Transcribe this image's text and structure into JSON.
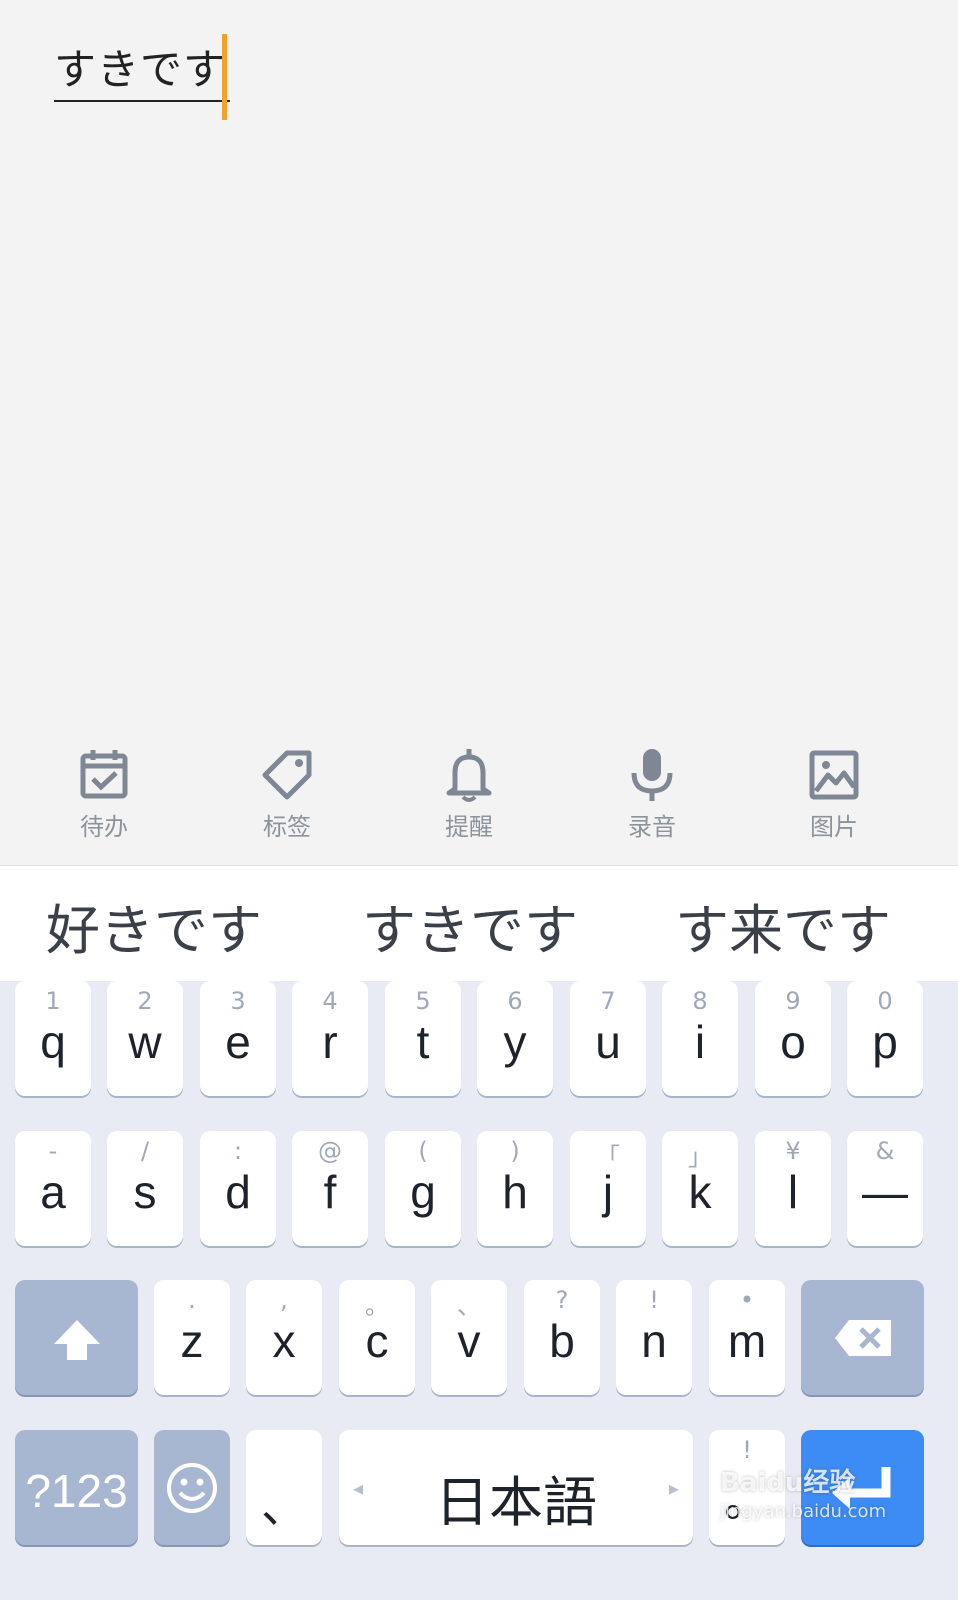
{
  "editor": {
    "composing_text": "すきです"
  },
  "toolbar": {
    "items": [
      {
        "label": "待办",
        "icon": "todo-calendar-icon"
      },
      {
        "label": "标签",
        "icon": "tag-icon"
      },
      {
        "label": "提醒",
        "icon": "bell-icon"
      },
      {
        "label": "录音",
        "icon": "microphone-icon"
      },
      {
        "label": "图片",
        "icon": "image-icon"
      }
    ]
  },
  "candidates": [
    "好きです",
    "すきです",
    "す来です"
  ],
  "keyboard": {
    "row1": [
      {
        "hint": "1",
        "ch": "q"
      },
      {
        "hint": "2",
        "ch": "w"
      },
      {
        "hint": "3",
        "ch": "e"
      },
      {
        "hint": "4",
        "ch": "r"
      },
      {
        "hint": "5",
        "ch": "t"
      },
      {
        "hint": "6",
        "ch": "y"
      },
      {
        "hint": "7",
        "ch": "u"
      },
      {
        "hint": "8",
        "ch": "i"
      },
      {
        "hint": "9",
        "ch": "o"
      },
      {
        "hint": "0",
        "ch": "p"
      }
    ],
    "row2": [
      {
        "hint": "-",
        "ch": "a"
      },
      {
        "hint": "/",
        "ch": "s"
      },
      {
        "hint": ":",
        "ch": "d"
      },
      {
        "hint": "@",
        "ch": "f"
      },
      {
        "hint": "(",
        "ch": "g"
      },
      {
        "hint": ")",
        "ch": "h"
      },
      {
        "hint": "「",
        "ch": "j"
      },
      {
        "hint": "」",
        "ch": "k"
      },
      {
        "hint": "¥",
        "ch": "l"
      },
      {
        "hint": "&",
        "ch": "—"
      }
    ],
    "row3": [
      {
        "hint": ".",
        "ch": "z"
      },
      {
        "hint": ",",
        "ch": "x"
      },
      {
        "hint": "。",
        "ch": "c"
      },
      {
        "hint": "、",
        "ch": "v"
      },
      {
        "hint": "?",
        "ch": "b"
      },
      {
        "hint": "!",
        "ch": "n"
      },
      {
        "hint": "•",
        "ch": "m"
      }
    ],
    "num_label": "?123",
    "comma_label": "、",
    "space_label": "日本語",
    "period_hint": "!",
    "period_label": "。",
    "shift_icon": "shift-arrow-icon",
    "delete_icon": "backspace-icon",
    "emoji_icon": "smiley-icon",
    "enter_icon": "enter-icon"
  },
  "watermark": {
    "brand": "Baidu经验",
    "url": "jingyan.baidu.com"
  }
}
